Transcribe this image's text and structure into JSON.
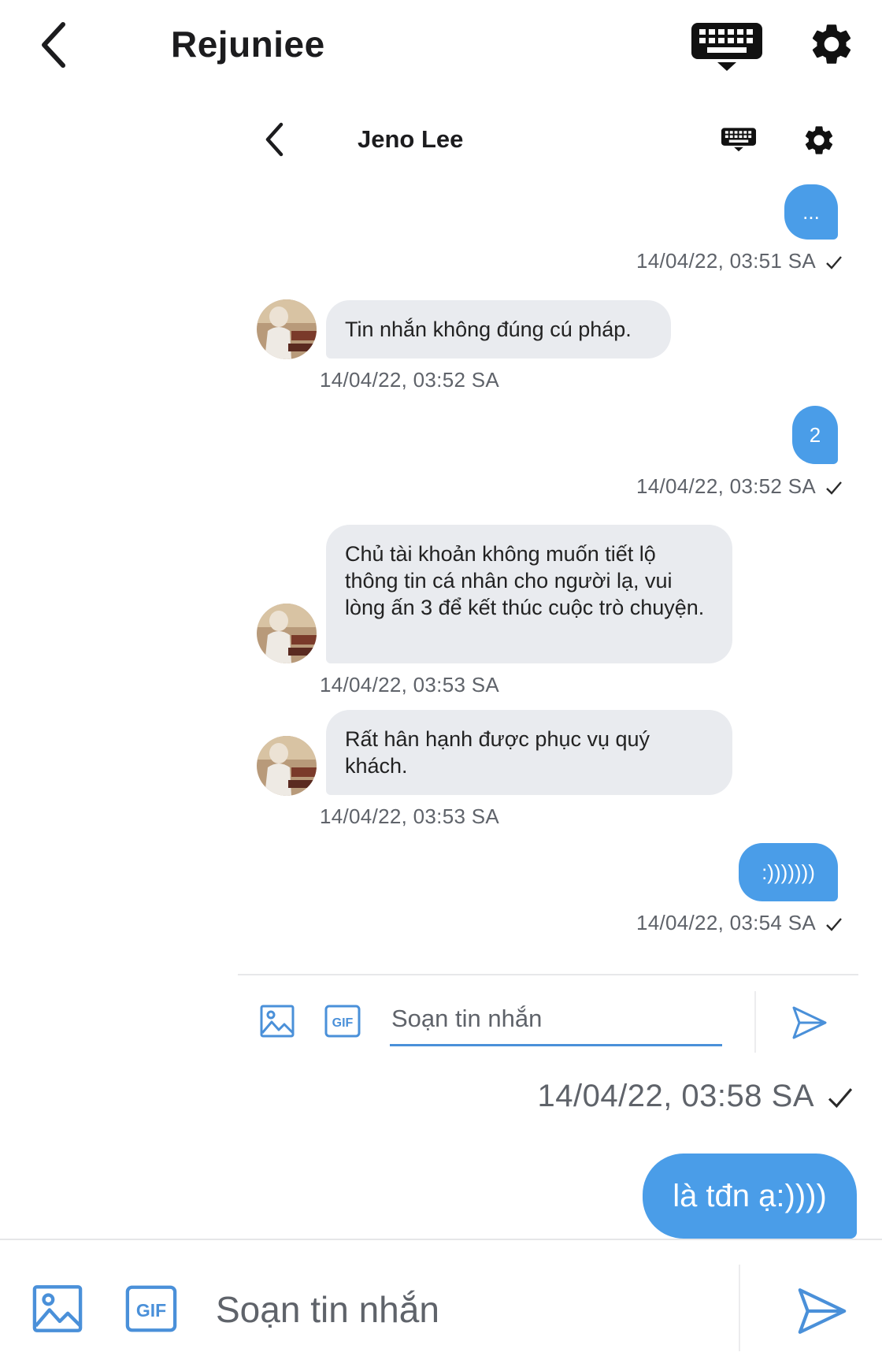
{
  "outer_header": {
    "title": "Rejuniee",
    "back_icon": "chevron-left-icon",
    "keyboard_icon": "keyboard-icon",
    "settings_icon": "gear-icon"
  },
  "inner_header": {
    "title": "Jeno Lee",
    "back_icon": "chevron-left-icon",
    "keyboard_icon": "keyboard-icon",
    "settings_icon": "gear-icon"
  },
  "messages": [
    {
      "dir": "out",
      "text": "...",
      "time": "14/04/22, 03:51 SA"
    },
    {
      "dir": "in",
      "text": "Tin nhắn không đúng cú pháp.",
      "time": "14/04/22, 03:52 SA"
    },
    {
      "dir": "out",
      "text": "2",
      "time": "14/04/22, 03:52 SA"
    },
    {
      "dir": "in",
      "text": "Chủ tài khoản không muốn tiết lộ thông tin cá nhân cho người lạ, vui lòng ấn 3 để kết thúc cuộc trò chuyện.",
      "time": "14/04/22, 03:53 SA"
    },
    {
      "dir": "in",
      "text": "Rất hân hạnh được phục vụ quý khách.",
      "time": "14/04/22, 03:53 SA"
    },
    {
      "dir": "out",
      "text": ":)))))))",
      "time": "14/04/22, 03:54 SA"
    }
  ],
  "inner_composer": {
    "placeholder": "Soạn tin nhắn",
    "gif_label": "GIF"
  },
  "outer_messages": [
    {
      "dir": "out",
      "text": "là tđn ạ:))))",
      "time": "14/04/22, 03:58 SA"
    }
  ],
  "outer_composer": {
    "placeholder": "Soạn tin nhắn",
    "gif_label": "GIF"
  },
  "colors": {
    "accent": "#4a9de8",
    "incoming_bubble": "#e9ebef",
    "timestamp": "#5f636a"
  }
}
